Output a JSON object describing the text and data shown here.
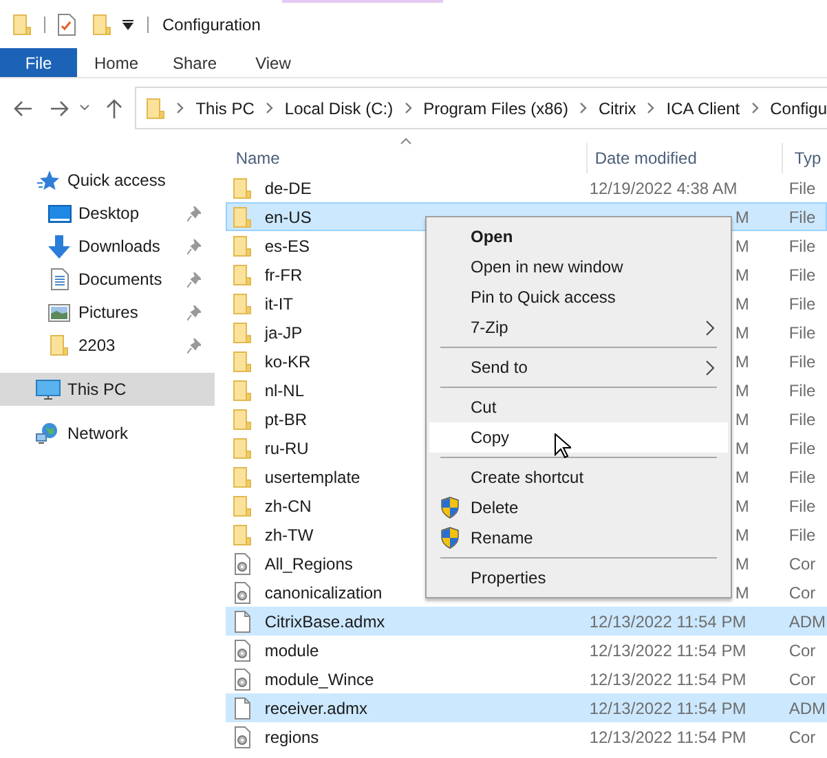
{
  "title_bar": {
    "title": "Configuration"
  },
  "ribbon_tabs": [
    {
      "label": "File",
      "kind": "file"
    },
    {
      "label": "Home",
      "kind": "tab"
    },
    {
      "label": "Share",
      "kind": "tab"
    },
    {
      "label": "View",
      "kind": "tab"
    }
  ],
  "address_bar": {
    "segments": [
      "This PC",
      "Local Disk (C:)",
      "Program Files (x86)",
      "Citrix",
      "ICA Client",
      "Configu"
    ]
  },
  "sidebar": {
    "items": [
      {
        "label": "Quick access",
        "kind": "star",
        "selected": false,
        "children": [
          {
            "label": "Desktop",
            "kind": "desktop",
            "pinned": true,
            "selected": false
          },
          {
            "label": "Downloads",
            "kind": "download",
            "pinned": true,
            "selected": false
          },
          {
            "label": "Documents",
            "kind": "document",
            "pinned": true,
            "selected": false
          },
          {
            "label": "Pictures",
            "kind": "pictures",
            "pinned": true,
            "selected": false
          },
          {
            "label": "2203",
            "kind": "folder",
            "pinned": true,
            "selected": false
          }
        ]
      },
      {
        "label": "This PC",
        "kind": "pc",
        "selected": true
      },
      {
        "label": "Network",
        "kind": "network",
        "selected": false
      }
    ]
  },
  "table": {
    "columns": [
      "Name",
      "Date modified",
      "Typ"
    ],
    "rows": [
      {
        "name": "de-DE",
        "kind": "folder",
        "date": "12/19/2022 4:38 AM",
        "date_cut": false,
        "type": "File",
        "selected": false,
        "focused": false
      },
      {
        "name": "en-US",
        "kind": "folder",
        "date": "M",
        "date_cut": true,
        "type": "File",
        "selected": true,
        "focused": true
      },
      {
        "name": "es-ES",
        "kind": "folder",
        "date": "M",
        "date_cut": true,
        "type": "File",
        "selected": false,
        "focused": false
      },
      {
        "name": "fr-FR",
        "kind": "folder",
        "date": "M",
        "date_cut": true,
        "type": "File",
        "selected": false,
        "focused": false
      },
      {
        "name": "it-IT",
        "kind": "folder",
        "date": "M",
        "date_cut": true,
        "type": "File",
        "selected": false,
        "focused": false
      },
      {
        "name": "ja-JP",
        "kind": "folder",
        "date": "M",
        "date_cut": true,
        "type": "File",
        "selected": false,
        "focused": false
      },
      {
        "name": "ko-KR",
        "kind": "folder",
        "date": "M",
        "date_cut": true,
        "type": "File",
        "selected": false,
        "focused": false
      },
      {
        "name": "nl-NL",
        "kind": "folder",
        "date": "M",
        "date_cut": true,
        "type": "File",
        "selected": false,
        "focused": false
      },
      {
        "name": "pt-BR",
        "kind": "folder",
        "date": "M",
        "date_cut": true,
        "type": "File",
        "selected": false,
        "focused": false
      },
      {
        "name": "ru-RU",
        "kind": "folder",
        "date": "M",
        "date_cut": true,
        "type": "File",
        "selected": false,
        "focused": false
      },
      {
        "name": "usertemplate",
        "kind": "folder",
        "date": "M",
        "date_cut": true,
        "type": "File",
        "selected": false,
        "focused": false
      },
      {
        "name": "zh-CN",
        "kind": "folder",
        "date": "M",
        "date_cut": true,
        "type": "File",
        "selected": false,
        "focused": false
      },
      {
        "name": "zh-TW",
        "kind": "folder",
        "date": "M",
        "date_cut": true,
        "type": "File",
        "selected": false,
        "focused": false
      },
      {
        "name": "All_Regions",
        "kind": "config",
        "date": "M",
        "date_cut": true,
        "type": "Cor",
        "selected": false,
        "focused": false
      },
      {
        "name": "canonicalization",
        "kind": "config",
        "date": "M",
        "date_cut": true,
        "type": "Cor",
        "selected": false,
        "focused": false
      },
      {
        "name": "CitrixBase.admx",
        "kind": "blank",
        "date": "12/13/2022 11:54 PM",
        "date_cut": false,
        "type": "ADM",
        "selected": true,
        "focused": false
      },
      {
        "name": "module",
        "kind": "config",
        "date": "12/13/2022 11:54 PM",
        "date_cut": false,
        "type": "Cor",
        "selected": false,
        "focused": false
      },
      {
        "name": "module_Wince",
        "kind": "config",
        "date": "12/13/2022 11:54 PM",
        "date_cut": false,
        "type": "Cor",
        "selected": false,
        "focused": false
      },
      {
        "name": "receiver.admx",
        "kind": "blank",
        "date": "12/13/2022 11:54 PM",
        "date_cut": false,
        "type": "ADM",
        "selected": true,
        "focused": false
      },
      {
        "name": "regions",
        "kind": "config",
        "date": "12/13/2022 11:54 PM",
        "date_cut": false,
        "type": "Cor",
        "selected": false,
        "focused": false
      }
    ]
  },
  "context_menu": {
    "items": [
      {
        "label": "Open",
        "kind": "item",
        "default": true,
        "hovered": false
      },
      {
        "label": "Open in new window",
        "kind": "item",
        "default": false,
        "hovered": false
      },
      {
        "label": "Pin to Quick access",
        "kind": "item",
        "default": false,
        "hovered": false
      },
      {
        "label": "7-Zip",
        "kind": "submenu",
        "default": false,
        "hovered": false
      },
      {
        "kind": "separator"
      },
      {
        "label": "Send to",
        "kind": "submenu",
        "default": false,
        "hovered": false
      },
      {
        "kind": "separator"
      },
      {
        "label": "Cut",
        "kind": "item",
        "default": false,
        "hovered": false
      },
      {
        "label": "Copy",
        "kind": "item",
        "default": false,
        "hovered": true
      },
      {
        "kind": "separator"
      },
      {
        "label": "Create shortcut",
        "kind": "item",
        "default": false,
        "hovered": false
      },
      {
        "label": "Delete",
        "kind": "shield",
        "default": false,
        "hovered": false
      },
      {
        "label": "Rename",
        "kind": "shield",
        "default": false,
        "hovered": false
      },
      {
        "kind": "separator"
      },
      {
        "label": "Properties",
        "kind": "item",
        "default": false,
        "hovered": false
      }
    ]
  }
}
